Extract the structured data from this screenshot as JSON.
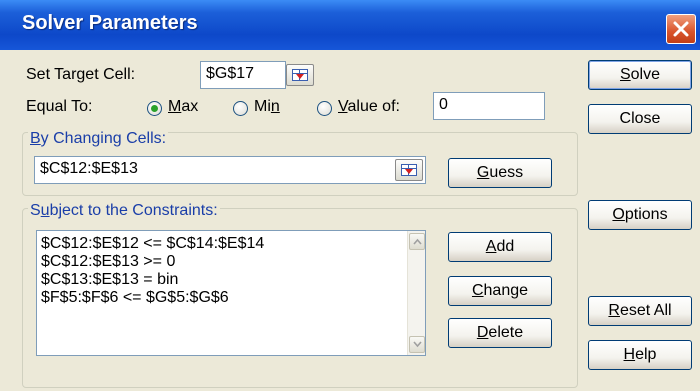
{
  "window": {
    "title": "Solver Parameters"
  },
  "target": {
    "label": "Set Target Cell:",
    "value": "$G$17"
  },
  "equal_to": {
    "label": "Equal To:",
    "options": [
      {
        "label": "Max",
        "checked": true
      },
      {
        "label": "Min",
        "checked": false
      },
      {
        "label": "Value of:",
        "checked": false
      }
    ],
    "value_of": "0"
  },
  "changing_cells": {
    "label": "By Changing Cells:",
    "value": "$C$12:$E$13"
  },
  "constraints": {
    "label": "Subject to the Constraints:",
    "items": [
      "$C$12:$E$12 <= $C$14:$E$14",
      "$C$12:$E$13 >= 0",
      "$C$13:$E$13 = bin",
      "$F$5:$F$6 <= $G$5:$G$6"
    ]
  },
  "buttons": {
    "solve": "Solve",
    "close": "Close",
    "guess": "Guess",
    "options": "Options",
    "add": "Add",
    "change": "Change",
    "delete": "Delete",
    "reset_all": "Reset All",
    "help": "Help"
  },
  "icons": {
    "close": "close-x-icon",
    "cell_ref": "collapse-dialog-icon",
    "scroll_up": "scroll-up-arrow",
    "scroll_down": "scroll-down-arrow"
  }
}
